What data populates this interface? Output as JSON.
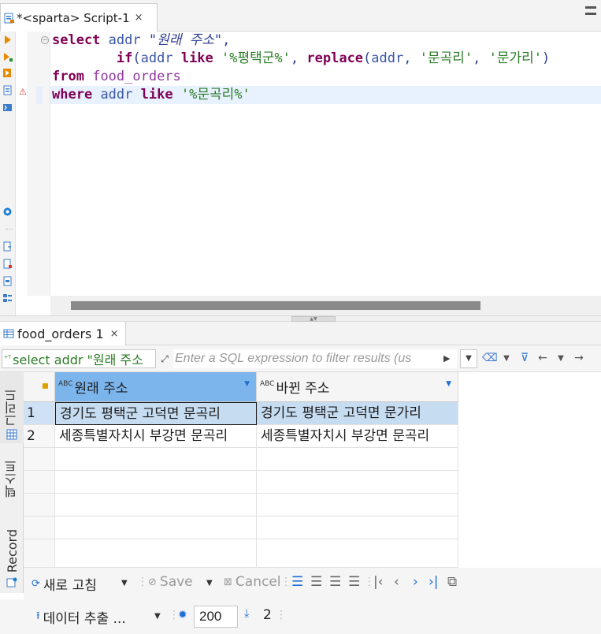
{
  "editor_tab": {
    "label": "*<sparta> Script-1",
    "close": "×"
  },
  "editor": {
    "kw_select": "select",
    "col_addr": "addr",
    "alias_original": "\"원래 주소\"",
    "comma": ",",
    "kw_if": "if",
    "if_open": "(",
    "kw_like": "like",
    "pat_pyeongtaek": "'%평택군%'",
    "kw_replace": "replace",
    "replace_args_sep": ", ",
    "str_mungokri": "'문곡리'",
    "str_mungari": "'문가리'",
    "close_paren": ")",
    "kw_from": "from",
    "table_name": "food_orders",
    "kw_where": "where",
    "pat_mungokri": "'%문곡리%'"
  },
  "result_tab": {
    "label": "food_orders 1",
    "close": "×"
  },
  "filter": {
    "sql_preview": "select addr \"원래 주소",
    "placeholder": "Enter a SQL expression to filter results (us"
  },
  "vertical_tabs": {
    "grid": "그리드",
    "text": "텍스트",
    "record": "Record"
  },
  "grid": {
    "columns": [
      {
        "type": "ABC",
        "label": "원래 주소"
      },
      {
        "type": "ABC",
        "label": "바뀐 주소"
      }
    ],
    "rows": [
      {
        "num": "1",
        "cells": [
          "경기도 평택군 고덕면 문곡리",
          "경기도 평택군 고덕면 문가리"
        ]
      },
      {
        "num": "2",
        "cells": [
          "세종특별자치시 부강면 문곡리",
          "세종특별자치시 부강면 문곡리"
        ]
      }
    ]
  },
  "toolbar": {
    "refresh": "새로 고침",
    "save": "Save",
    "cancel": "Cancel",
    "export": "데이터 추출 ...",
    "fetch_size": "200",
    "row_count": "2"
  },
  "colors": {
    "header_selected": "#7cb5ec",
    "cell_selected": "#c6dcf1",
    "keyword": "#7f0055",
    "string": "#2a7b26"
  }
}
